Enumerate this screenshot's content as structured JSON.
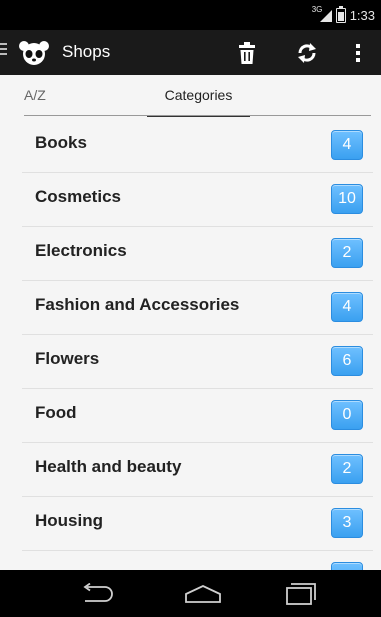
{
  "statusbar": {
    "network": "3G",
    "time": "1:33"
  },
  "actionbar": {
    "title": "Shops"
  },
  "tabs": {
    "az": "A/Z",
    "categories": "Categories"
  },
  "categories": [
    {
      "label": "Books",
      "count": "4"
    },
    {
      "label": "Cosmetics",
      "count": "10"
    },
    {
      "label": "Electronics",
      "count": "2"
    },
    {
      "label": "Fashion and Accessories",
      "count": "4"
    },
    {
      "label": "Flowers",
      "count": "6"
    },
    {
      "label": "Food",
      "count": "0"
    },
    {
      "label": "Health and beauty",
      "count": "2"
    },
    {
      "label": "Housing",
      "count": "3"
    },
    {
      "label": "",
      "count": ""
    }
  ],
  "colors": {
    "accent": "#3aa0f0",
    "actionbar": "#1a1a1a"
  }
}
